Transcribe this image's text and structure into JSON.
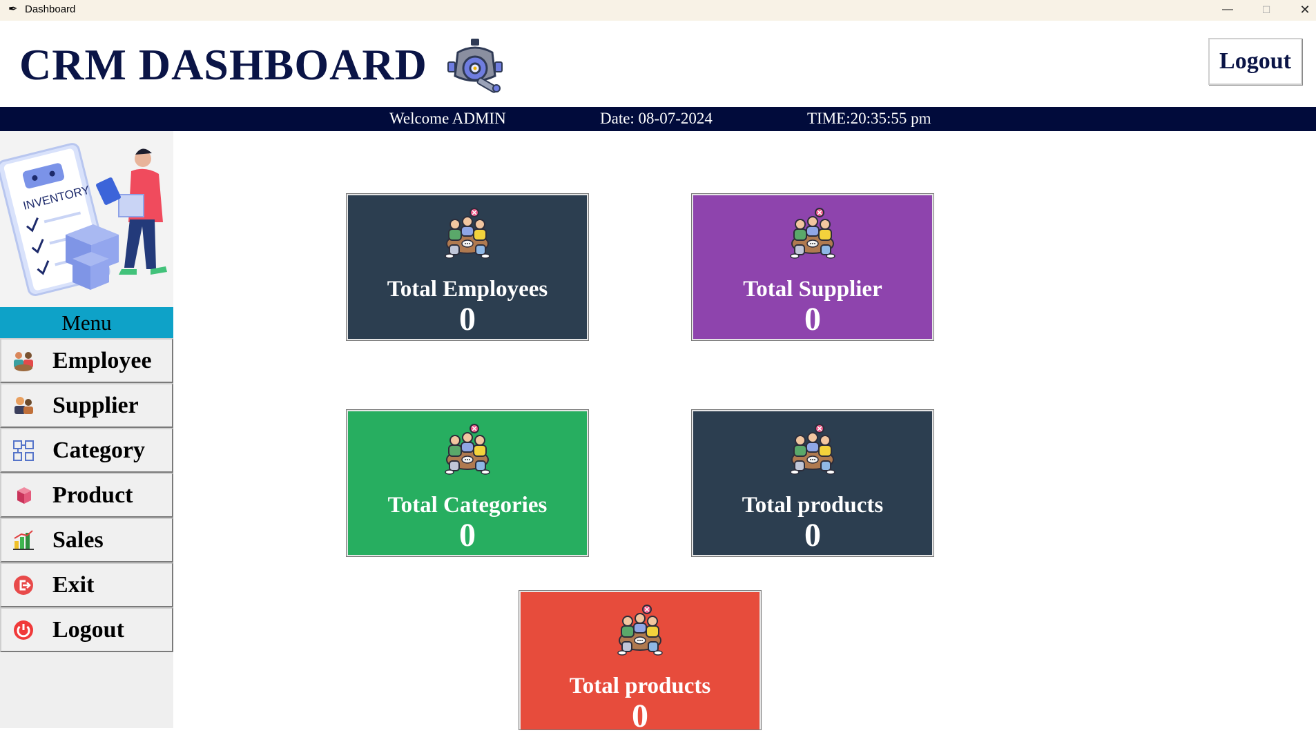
{
  "window": {
    "title": "Dashboard"
  },
  "header": {
    "app_title": "CRM DASHBOARD",
    "logout_label": "Logout"
  },
  "infobar": {
    "welcome": "Welcome ADMIN",
    "date": "Date: 08-07-2024",
    "time": "TIME:20:35:55 pm"
  },
  "sidebar": {
    "menu_title": "Menu",
    "items": [
      {
        "label": "Employee",
        "icon": "team-icon"
      },
      {
        "label": "Supplier",
        "icon": "supplier-icon"
      },
      {
        "label": "Category",
        "icon": "category-icon"
      },
      {
        "label": "Product",
        "icon": "box-icon"
      },
      {
        "label": "Sales",
        "icon": "bar-chart-icon"
      },
      {
        "label": "Exit",
        "icon": "exit-icon"
      },
      {
        "label": "Logout",
        "icon": "power-icon"
      }
    ]
  },
  "cards": [
    {
      "label": "Total Employees",
      "value": "0",
      "color": "#2c3e50"
    },
    {
      "label": "Total Supplier",
      "value": "0",
      "color": "#8e44ad"
    },
    {
      "label": "Total Categories",
      "value": "0",
      "color": "#27ae60"
    },
    {
      "label": "Total products",
      "value": "0",
      "color": "#2c3e50"
    },
    {
      "label": "Total products",
      "value": "0",
      "color": "#e74c3c"
    }
  ],
  "colors": {
    "title": "#0a1446",
    "infobar": "#010b3b",
    "menu_header": "#0ea2c8"
  }
}
